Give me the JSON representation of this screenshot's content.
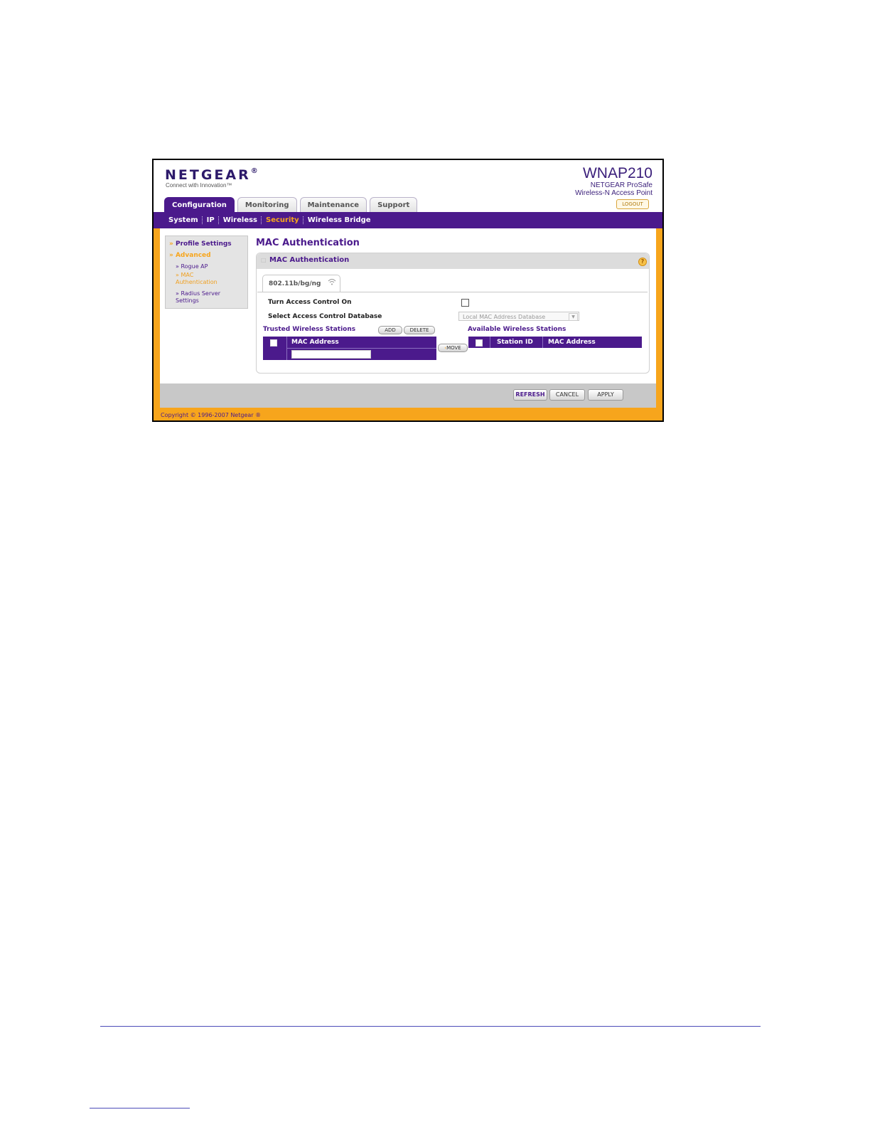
{
  "brand": {
    "logo": "NETGEAR",
    "logo_mark": "®",
    "tagline": "Connect with Innovation™"
  },
  "product": {
    "model": "WNAP210",
    "line1": "NETGEAR ProSafe",
    "line2": "Wireless-N Access Point",
    "logout": "LOGOUT"
  },
  "tabs": [
    {
      "label": "Configuration",
      "active": true
    },
    {
      "label": "Monitoring"
    },
    {
      "label": "Maintenance"
    },
    {
      "label": "Support"
    }
  ],
  "subnav": [
    {
      "label": "System"
    },
    {
      "label": "IP"
    },
    {
      "label": "Wireless"
    },
    {
      "label": "Security",
      "active": true
    },
    {
      "label": "Wireless Bridge"
    }
  ],
  "sidebar": {
    "profile": "Profile Settings",
    "advanced": "Advanced",
    "items": [
      {
        "label": "Rogue AP"
      },
      {
        "label": "MAC Authentication",
        "active": true
      },
      {
        "label": "Radius Server Settings"
      }
    ]
  },
  "page_title": "MAC Authentication",
  "panel": {
    "title": "MAC Authentication",
    "radio_tab": "802.11b/bg/ng",
    "turn_on_label": "Turn Access Control On",
    "select_db_label": "Select Access Control Database",
    "select_db_value": "Local MAC Address Database",
    "trusted_title": "Trusted Wireless Stations",
    "add": "ADD",
    "delete": "DELETE",
    "move": "MOVE",
    "trusted_col": "MAC Address",
    "available_title": "Available Wireless Stations",
    "available_cols": [
      "Station ID",
      "MAC Address"
    ]
  },
  "buttons": {
    "refresh": "REFRESH",
    "cancel": "CANCEL",
    "apply": "APPLY"
  },
  "copyright": "Copyright © 1996-2007 Netgear ®",
  "colors": {
    "purple": "#4b1a8c",
    "orange": "#f7a51c",
    "gray": "#c8c8c8"
  }
}
